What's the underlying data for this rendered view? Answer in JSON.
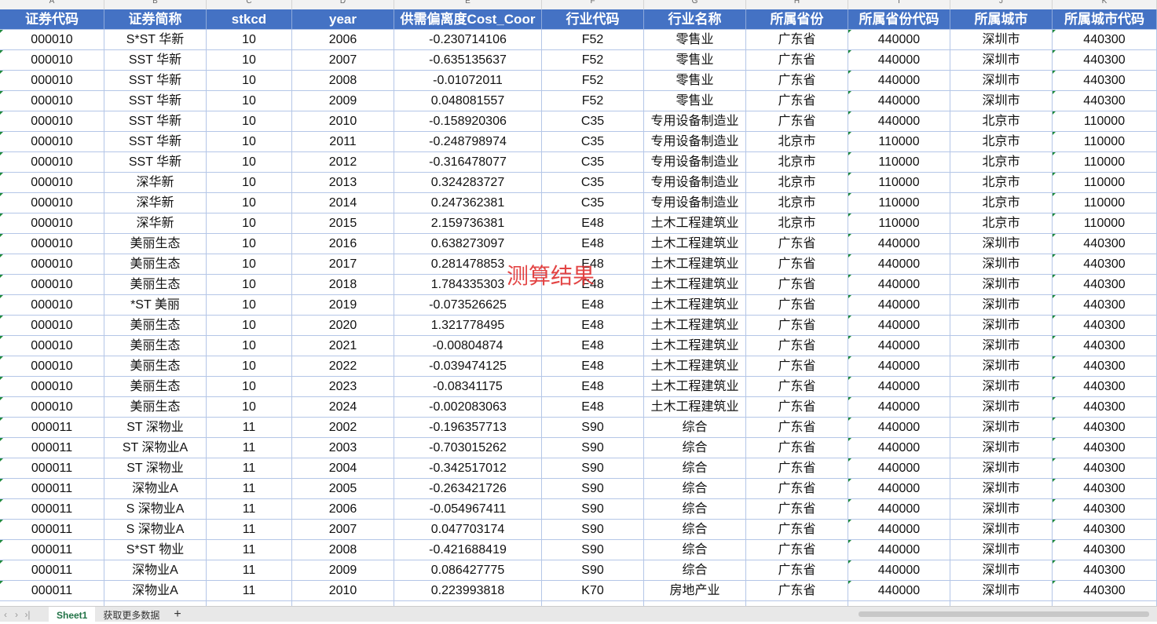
{
  "column_letters": [
    "A",
    "B",
    "C",
    "D",
    "E",
    "F",
    "G",
    "H",
    "I",
    "J",
    "K"
  ],
  "headers": [
    "证券代码",
    "证券简称",
    "stkcd",
    "year",
    "供需偏离度Cost_Coor",
    "行业代码",
    "行业名称",
    "所属省份",
    "所属省份代码",
    "所属城市",
    "所属城市代码"
  ],
  "rows": [
    [
      "000010",
      "S*ST 华新",
      "10",
      "2006",
      "-0.230714106",
      "F52",
      "零售业",
      "广东省",
      "440000",
      "深圳市",
      "440300"
    ],
    [
      "000010",
      "SST 华新",
      "10",
      "2007",
      "-0.635135637",
      "F52",
      "零售业",
      "广东省",
      "440000",
      "深圳市",
      "440300"
    ],
    [
      "000010",
      "SST 华新",
      "10",
      "2008",
      "-0.01072011",
      "F52",
      "零售业",
      "广东省",
      "440000",
      "深圳市",
      "440300"
    ],
    [
      "000010",
      "SST 华新",
      "10",
      "2009",
      "0.048081557",
      "F52",
      "零售业",
      "广东省",
      "440000",
      "深圳市",
      "440300"
    ],
    [
      "000010",
      "SST 华新",
      "10",
      "2010",
      "-0.158920306",
      "C35",
      "专用设备制造业",
      "广东省",
      "440000",
      "北京市",
      "110000"
    ],
    [
      "000010",
      "SST 华新",
      "10",
      "2011",
      "-0.248798974",
      "C35",
      "专用设备制造业",
      "北京市",
      "110000",
      "北京市",
      "110000"
    ],
    [
      "000010",
      "SST 华新",
      "10",
      "2012",
      "-0.316478077",
      "C35",
      "专用设备制造业",
      "北京市",
      "110000",
      "北京市",
      "110000"
    ],
    [
      "000010",
      "深华新",
      "10",
      "2013",
      "0.324283727",
      "C35",
      "专用设备制造业",
      "北京市",
      "110000",
      "北京市",
      "110000"
    ],
    [
      "000010",
      "深华新",
      "10",
      "2014",
      "0.247362381",
      "C35",
      "专用设备制造业",
      "北京市",
      "110000",
      "北京市",
      "110000"
    ],
    [
      "000010",
      "深华新",
      "10",
      "2015",
      "2.159736381",
      "E48",
      "土木工程建筑业",
      "北京市",
      "110000",
      "北京市",
      "110000"
    ],
    [
      "000010",
      "美丽生态",
      "10",
      "2016",
      "0.638273097",
      "E48",
      "土木工程建筑业",
      "广东省",
      "440000",
      "深圳市",
      "440300"
    ],
    [
      "000010",
      "美丽生态",
      "10",
      "2017",
      "0.281478853",
      "E48",
      "土木工程建筑业",
      "广东省",
      "440000",
      "深圳市",
      "440300"
    ],
    [
      "000010",
      "美丽生态",
      "10",
      "2018",
      "1.784335303",
      "E48",
      "土木工程建筑业",
      "广东省",
      "440000",
      "深圳市",
      "440300"
    ],
    [
      "000010",
      "*ST 美丽",
      "10",
      "2019",
      "-0.073526625",
      "E48",
      "土木工程建筑业",
      "广东省",
      "440000",
      "深圳市",
      "440300"
    ],
    [
      "000010",
      "美丽生态",
      "10",
      "2020",
      "1.321778495",
      "E48",
      "土木工程建筑业",
      "广东省",
      "440000",
      "深圳市",
      "440300"
    ],
    [
      "000010",
      "美丽生态",
      "10",
      "2021",
      "-0.00804874",
      "E48",
      "土木工程建筑业",
      "广东省",
      "440000",
      "深圳市",
      "440300"
    ],
    [
      "000010",
      "美丽生态",
      "10",
      "2022",
      "-0.039474125",
      "E48",
      "土木工程建筑业",
      "广东省",
      "440000",
      "深圳市",
      "440300"
    ],
    [
      "000010",
      "美丽生态",
      "10",
      "2023",
      "-0.08341175",
      "E48",
      "土木工程建筑业",
      "广东省",
      "440000",
      "深圳市",
      "440300"
    ],
    [
      "000010",
      "美丽生态",
      "10",
      "2024",
      "-0.002083063",
      "E48",
      "土木工程建筑业",
      "广东省",
      "440000",
      "深圳市",
      "440300"
    ],
    [
      "000011",
      "ST 深物业",
      "11",
      "2002",
      "-0.196357713",
      "S90",
      "综合",
      "广东省",
      "440000",
      "深圳市",
      "440300"
    ],
    [
      "000011",
      "ST 深物业A",
      "11",
      "2003",
      "-0.703015262",
      "S90",
      "综合",
      "广东省",
      "440000",
      "深圳市",
      "440300"
    ],
    [
      "000011",
      "ST 深物业",
      "11",
      "2004",
      "-0.342517012",
      "S90",
      "综合",
      "广东省",
      "440000",
      "深圳市",
      "440300"
    ],
    [
      "000011",
      "深物业A",
      "11",
      "2005",
      "-0.263421726",
      "S90",
      "综合",
      "广东省",
      "440000",
      "深圳市",
      "440300"
    ],
    [
      "000011",
      "S 深物业A",
      "11",
      "2006",
      "-0.054967411",
      "S90",
      "综合",
      "广东省",
      "440000",
      "深圳市",
      "440300"
    ],
    [
      "000011",
      "S 深物业A",
      "11",
      "2007",
      "0.047703174",
      "S90",
      "综合",
      "广东省",
      "440000",
      "深圳市",
      "440300"
    ],
    [
      "000011",
      "S*ST 物业",
      "11",
      "2008",
      "-0.421688419",
      "S90",
      "综合",
      "广东省",
      "440000",
      "深圳市",
      "440300"
    ],
    [
      "000011",
      "深物业A",
      "11",
      "2009",
      "0.086427775",
      "S90",
      "综合",
      "广东省",
      "440000",
      "深圳市",
      "440300"
    ],
    [
      "000011",
      "深物业A",
      "11",
      "2010",
      "0.223993818",
      "K70",
      "房地产业",
      "广东省",
      "440000",
      "深圳市",
      "440300"
    ]
  ],
  "watermark": "测算结果",
  "sheet_tabs": [
    "Sheet1",
    "获取更多数据"
  ],
  "add_sheet_label": "+",
  "nav": [
    "‹",
    "›",
    "›|"
  ]
}
